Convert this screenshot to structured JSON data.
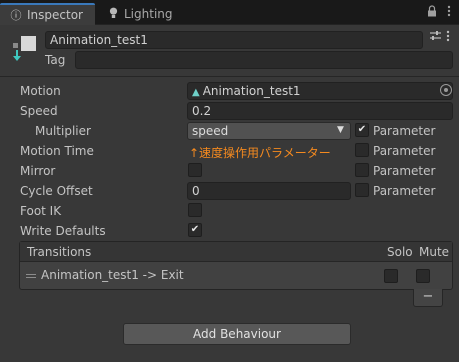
{
  "tabs": [
    {
      "label": "Inspector",
      "icon": "info-icon",
      "active": true
    },
    {
      "label": "Lighting",
      "icon": "lightbulb-icon",
      "active": false
    }
  ],
  "window_menu": {
    "lock_icon": "lock-icon",
    "more_icon": "kebab-menu-icon"
  },
  "header": {
    "name": "Animation_test1",
    "tag_label": "Tag",
    "tag_value": ""
  },
  "properties": {
    "motion_label": "Motion",
    "motion_value": "Animation_test1",
    "speed_label": "Speed",
    "speed_value": "0.2",
    "multiplier_label": "Multiplier",
    "multiplier_value": "speed",
    "multiplier_param_checked": true,
    "motion_time_label": "Motion Time",
    "motion_time_note": "↑速度操作用パラメーター",
    "motion_time_param_checked": false,
    "mirror_label": "Mirror",
    "mirror_checked": false,
    "mirror_param_checked": false,
    "cycle_offset_label": "Cycle Offset",
    "cycle_offset_value": "0",
    "cycle_offset_param_checked": false,
    "foot_ik_label": "Foot IK",
    "foot_ik_checked": false,
    "write_defaults_label": "Write Defaults",
    "write_defaults_checked": true,
    "parameter_label": "Parameter"
  },
  "transitions": {
    "title": "Transitions",
    "solo_label": "Solo",
    "mute_label": "Mute",
    "rows": [
      {
        "label": "Animation_test1 -> Exit",
        "solo": false,
        "mute": false
      }
    ],
    "remove_label": "−"
  },
  "add_behaviour_label": "Add Behaviour",
  "colors": {
    "accent": "#3a79bb",
    "note": "#f58a1f",
    "background": "#383838"
  }
}
